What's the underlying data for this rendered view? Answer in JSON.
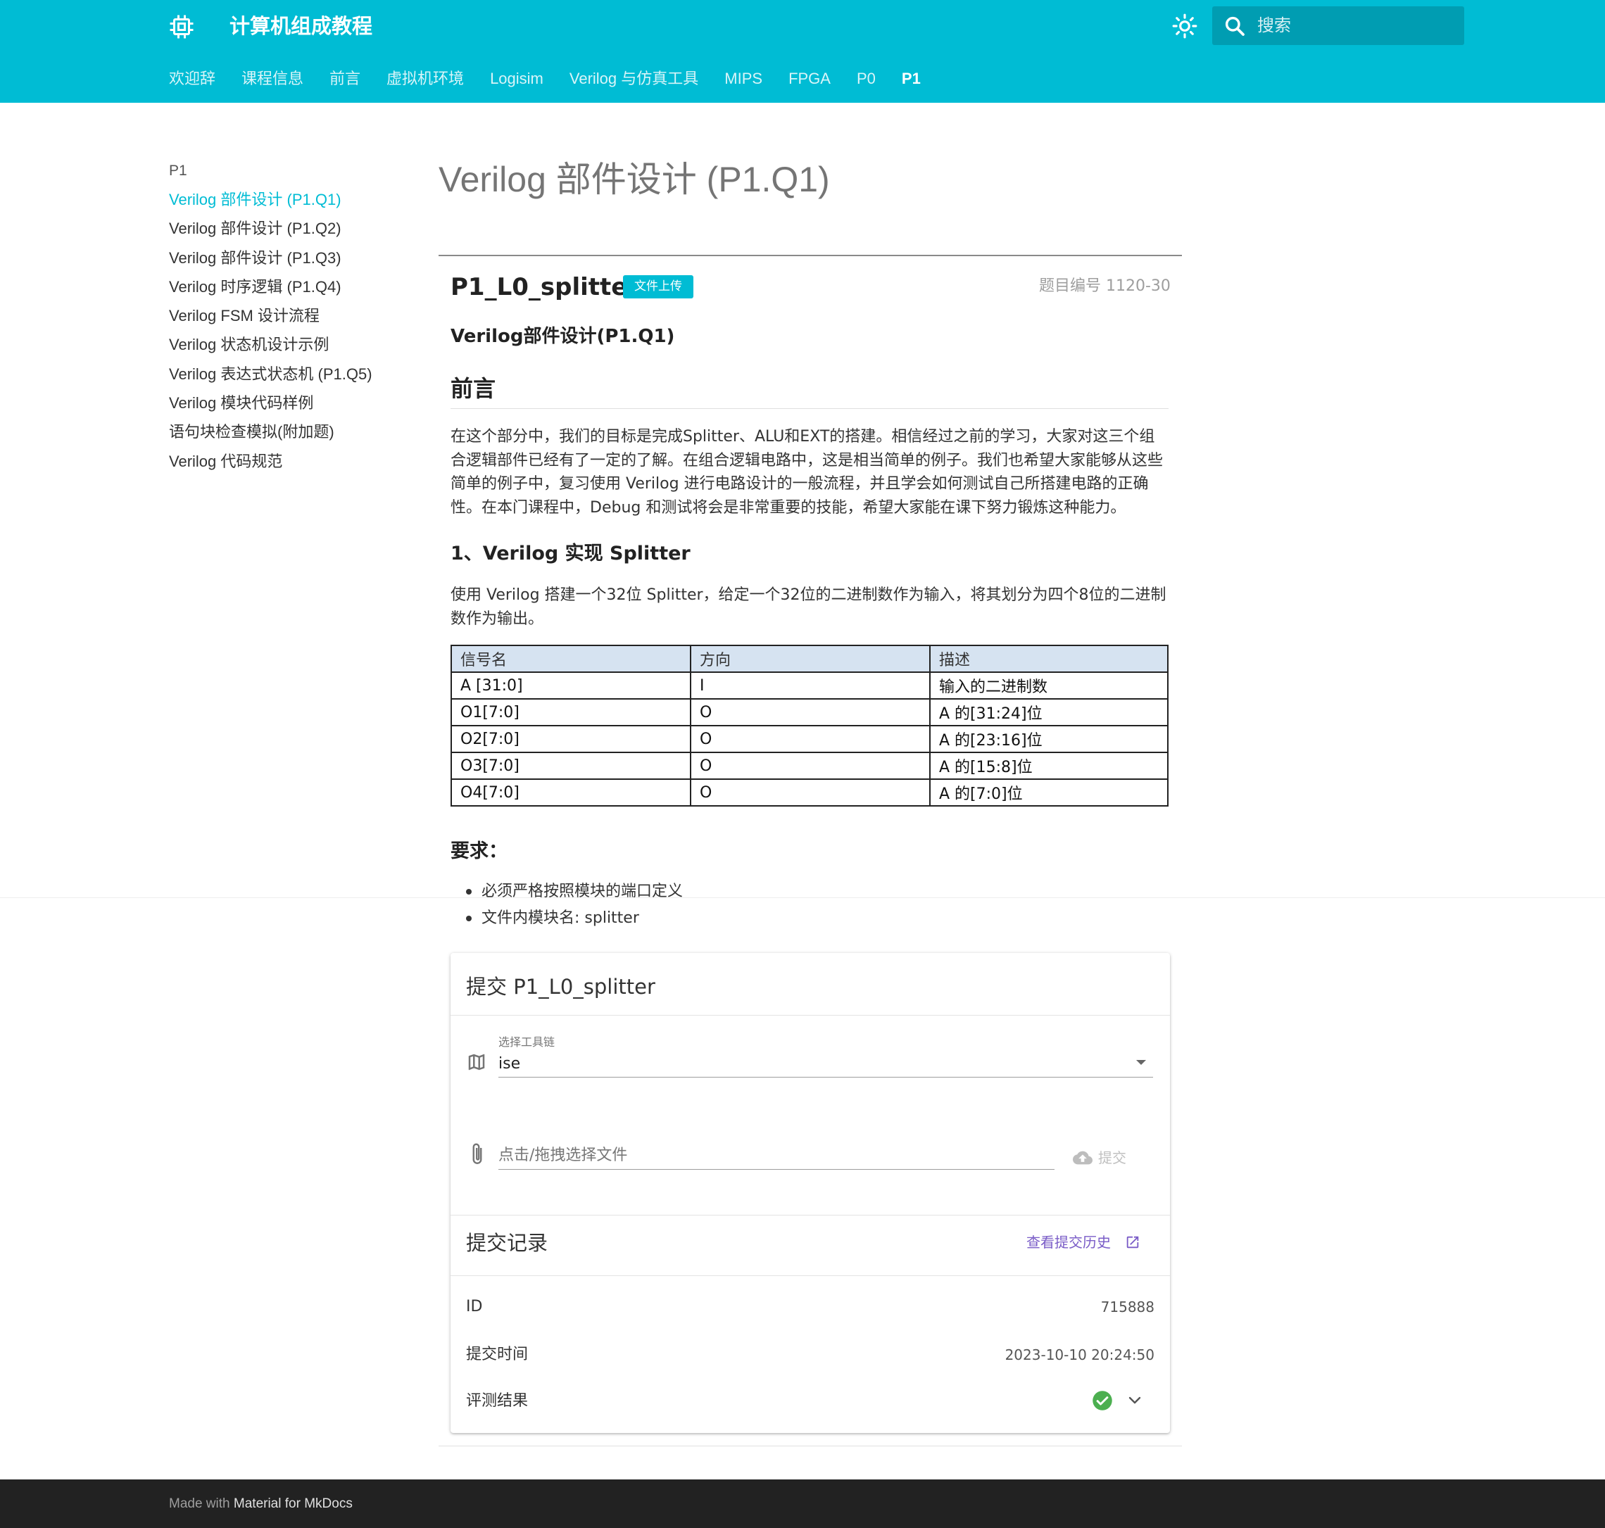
{
  "header": {
    "site_title": "计算机组成教程",
    "search_placeholder": "搜索",
    "tabs": [
      "欢迎辞",
      "课程信息",
      "前言",
      "虚拟机环境",
      "Logisim",
      "Verilog 与仿真工具",
      "MIPS",
      "FPGA",
      "P0",
      "P1"
    ],
    "active_tab": "P1",
    "icons": {
      "logo": "chip-icon",
      "theme": "brightness-icon",
      "search": "search-icon"
    }
  },
  "sidebar": {
    "section": "P1",
    "items": [
      "Verilog 部件设计 (P1.Q1)",
      "Verilog 部件设计 (P1.Q2)",
      "Verilog 部件设计 (P1.Q3)",
      "Verilog 时序逻辑 (P1.Q4)",
      "Verilog FSM 设计流程",
      "Verilog 状态机设计示例",
      "Verilog 表达式状态机 (P1.Q5)",
      "Verilog 模块代码样例",
      "语句块检查模拟(附加题)",
      "Verilog 代码规范"
    ],
    "active_index": 0
  },
  "content": {
    "page_title": "Verilog 部件设计 (P1.Q1)",
    "problem_title": "P1_L0_splitter",
    "badge": "文件上传",
    "problem_id": "题目编号 1120-30",
    "subtitle": "Verilog部件设计(P1.Q1)",
    "preface_heading": "前言",
    "preface_text": "在这个部分中，我们的目标是完成Splitter、ALU和EXT的搭建。相信经过之前的学习，大家对这三个组合逻辑部件已经有了一定的了解。在组合逻辑电路中，这是相当简单的例子。我们也希望大家能够从这些简单的例子中，复习使用 Verilog 进行电路设计的一般流程，并且学会如何测试自己所搭建电路的正确性。在本门课程中，Debug 和测试将会是非常重要的技能，希望大家能在课下努力锻炼这种能力。",
    "splitter_heading": "1、Verilog 实现 Splitter",
    "splitter_text": "使用 Verilog 搭建一个32位 Splitter，给定一个32位的二进制数作为输入，将其划分为四个8位的二进制数作为输出。",
    "table": {
      "headers": [
        "信号名",
        "方向",
        "描述"
      ],
      "rows": [
        [
          "A [31:0]",
          "I",
          "输入的二进制数"
        ],
        [
          "O1[7:0]",
          "O",
          "A 的[31:24]位"
        ],
        [
          "O2[7:0]",
          "O",
          "A 的[23:16]位"
        ],
        [
          "O3[7:0]",
          "O",
          "A 的[15:8]位"
        ],
        [
          "O4[7:0]",
          "O",
          "A 的[7:0]位"
        ]
      ]
    },
    "req_heading": "要求：",
    "requirements": [
      "必须严格按照模块的端口定义",
      "文件内模块名: splitter"
    ]
  },
  "submit_card": {
    "title": "提交 P1_L0_splitter",
    "toolchain_label": "选择工具链",
    "toolchain_value": "ise",
    "file_placeholder": "点击/拖拽选择文件",
    "submit_label": "提交",
    "records_title": "提交记录",
    "history_link": "查看提交历史",
    "record": {
      "id_label": "ID",
      "id_value": "715888",
      "time_label": "提交时间",
      "time_value": "2023-10-10 20:24:50",
      "result_label": "评测结果",
      "result_status": "accepted"
    },
    "colors": {
      "success": "#4caf50",
      "link": "#7a5cc7"
    }
  },
  "footer": {
    "prefix": "Made with",
    "brand": "Material for MkDocs"
  },
  "colors": {
    "primary": "#00bcd4",
    "footer_bg": "#222222"
  }
}
